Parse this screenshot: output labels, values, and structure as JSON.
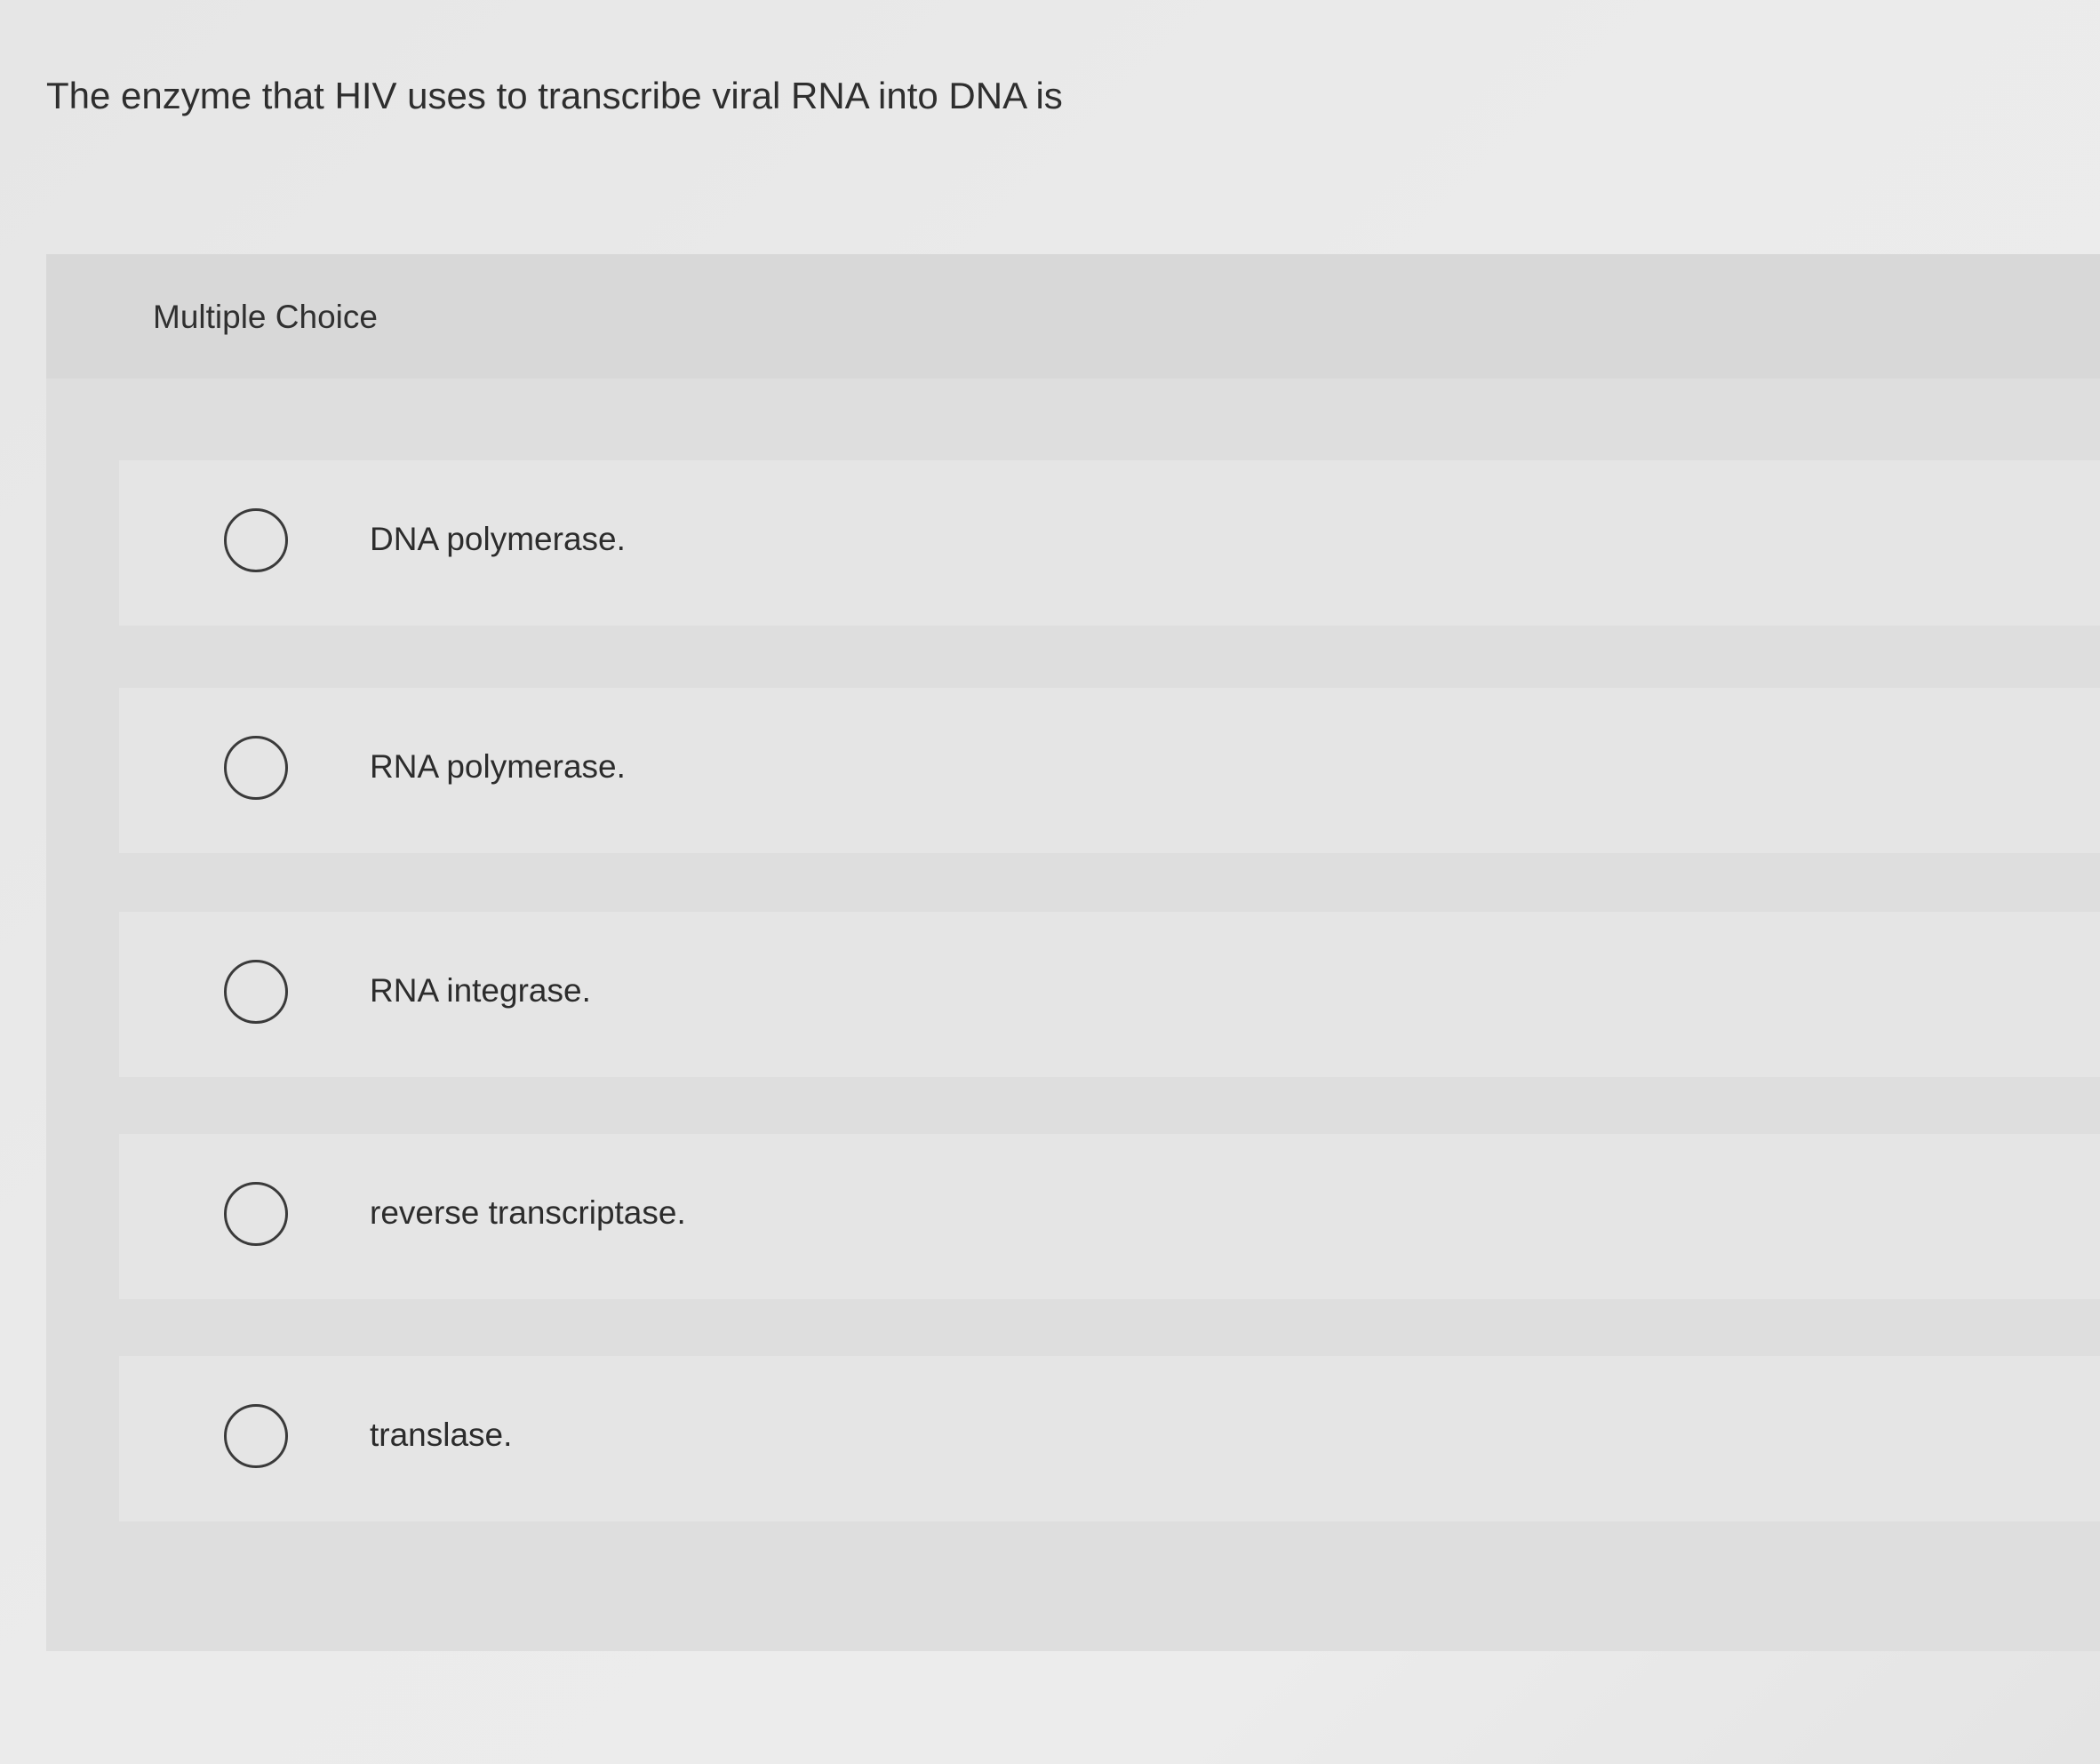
{
  "question": {
    "text": "The enzyme that HIV uses to transcribe viral RNA into DNA is"
  },
  "answer_panel": {
    "label": "Multiple Choice",
    "options": [
      {
        "text": "DNA polymerase.",
        "selected": false
      },
      {
        "text": "RNA polymerase.",
        "selected": false
      },
      {
        "text": "RNA integrase.",
        "selected": false
      },
      {
        "text": "reverse transcriptase.",
        "selected": false
      },
      {
        "text": "translase.",
        "selected": false
      }
    ]
  },
  "colors": {
    "background": "#e9e9e9",
    "panel": "#dedede",
    "option_row": "#e5e5e5",
    "text": "#2c2c2c",
    "radio_border": "#3a3a3a"
  }
}
